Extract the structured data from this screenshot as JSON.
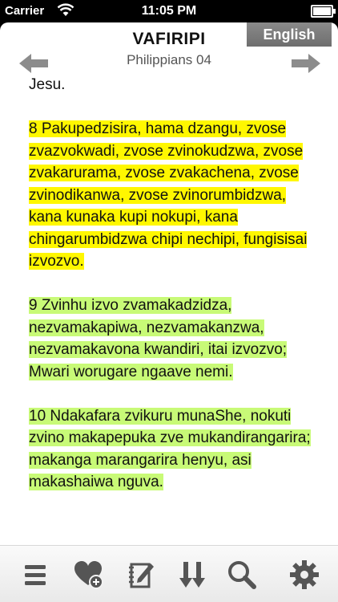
{
  "status": {
    "carrier": "Carrier",
    "time": "11:05 PM"
  },
  "header": {
    "book_title": "VAFIRIPI",
    "chapter": "Philippians 04",
    "language_button": "English"
  },
  "verses": [
    {
      "text": "Jesu.",
      "highlight": "none"
    },
    {
      "text": "8 Pakupedzisira, hama dzangu, zvose zvazvokwadi, zvose zvinokudzwa, zvose zvakarurama, zvose zvakachena, zvose zvinodikanwa, zvose zvinorumbidzwa, kana kunaka kupi nokupi, kana chingarumbidzwa chipi nechipi, fungisisai izvozvo.",
      "highlight": "yellow"
    },
    {
      "text": "9 Zvinhu izvo zvamakadzidza, nezvamakapiwa, nezvamakanzwa, nezvamakavona kwandiri, itai izvozvo; Mwari worugare ngaave nemi.",
      "highlight": "green"
    },
    {
      "text": "10 Ndakafara zvikuru munaShe, nokuti zvino makapepuka zve mukandirangarira; makanga marangarira henyu, asi makashaiwa nguva.",
      "highlight": "green"
    }
  ],
  "toolbar": {
    "icons": [
      "menu-icon",
      "favorite-add-icon",
      "notes-icon",
      "scroll-arrows-icon",
      "search-icon",
      "gear-icon"
    ]
  },
  "colors": {
    "yellow_highlight": "#fff700",
    "green_highlight": "#c8fa77",
    "language_button": "#7b7b7b"
  }
}
